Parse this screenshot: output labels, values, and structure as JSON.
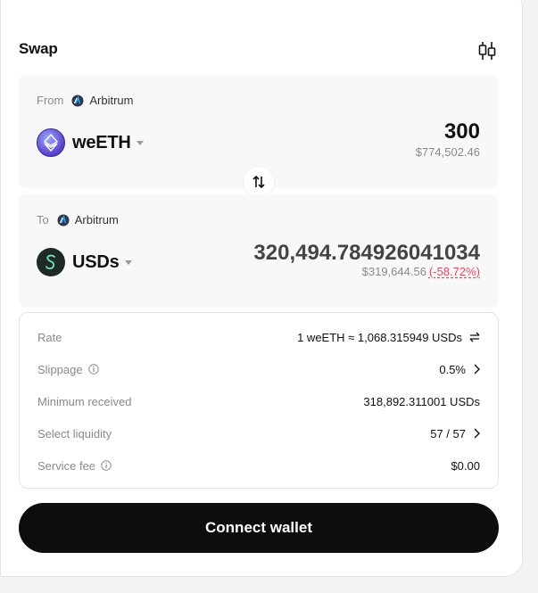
{
  "header": {
    "title": "Swap",
    "chart_icon": "candlestick-chart-icon"
  },
  "from": {
    "label": "From",
    "network": "Arbitrum",
    "network_icon": "arbitrum-icon",
    "token": "weETH",
    "token_icon": "weeth-token-icon",
    "amount": "300",
    "usd_value": "$774,502.46"
  },
  "flip_icon": "swap-direction-icon",
  "to": {
    "label": "To",
    "network": "Arbitrum",
    "network_icon": "arbitrum-icon",
    "token": "USDs",
    "token_icon": "usds-token-icon",
    "amount": "320,494.784926041034",
    "usd_value": "$319,644.56",
    "price_impact": "(-58.72%)"
  },
  "details": {
    "rate": {
      "label": "Rate",
      "value": "1 weETH ≈ 1,068.315949 USDs"
    },
    "slippage": {
      "label": "Slippage",
      "value": "0.5%"
    },
    "min_received": {
      "label": "Minimum received",
      "value": "318,892.311001 USDs"
    },
    "liquidity": {
      "label": "Select liquidity",
      "value": "57 / 57"
    },
    "service_fee": {
      "label": "Service fee",
      "value": "$0.00"
    }
  },
  "connect_label": "Connect wallet",
  "colors": {
    "negative": "#e04a5f",
    "button_bg": "#0d0d0d",
    "panel_bg": "#f8f8f8"
  }
}
